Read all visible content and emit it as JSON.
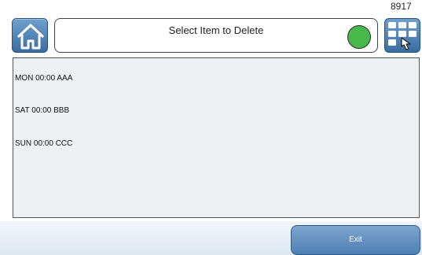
{
  "corner_id": "8917",
  "header": {
    "title": "Select Item to Delete",
    "home_icon": "home-icon",
    "menu_icon": "grid-touch-icon",
    "status_color": "#49b84d"
  },
  "items": [
    {
      "label": "MON 00:00  AAA"
    },
    {
      "label": "SAT 00:00  BBB"
    },
    {
      "label": "SUN 00:00  CCC"
    }
  ],
  "footer": {
    "exit_label": "Exit"
  }
}
